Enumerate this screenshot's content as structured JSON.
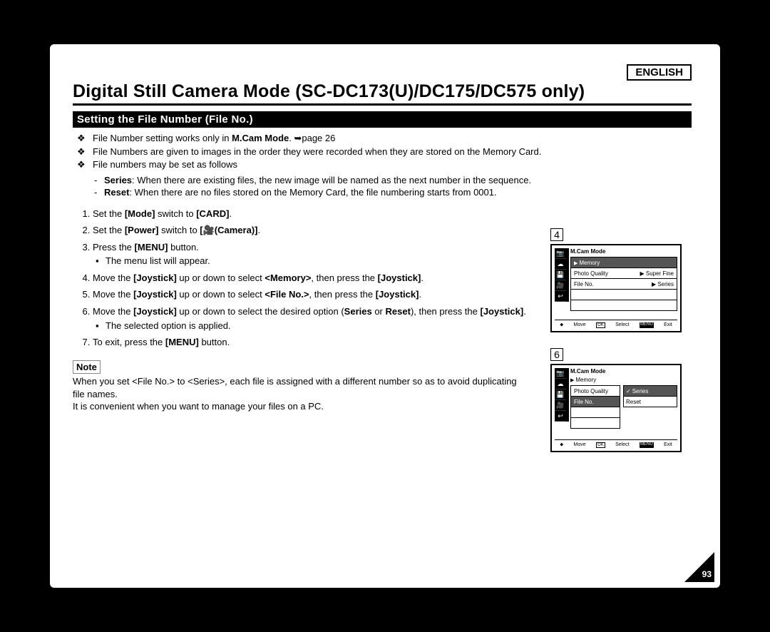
{
  "language": "ENGLISH",
  "title": "Digital Still Camera Mode (SC-DC173(U)/DC175/DC575 only)",
  "subtitle": "Setting the File Number (File No.)",
  "bullets": [
    "File Number setting works only in <b>M.Cam Mode</b>. ➥page 26",
    "File Numbers are given to images in the order they were recorded when they are stored on the Memory Card.",
    "File numbers may be set as follows"
  ],
  "sub_bullets": [
    "<b>Series</b>: When there are existing files, the new image will be named as the next number in the sequence.",
    "<b>Reset</b>: When there are no files stored on the Memory Card, the file numbering starts from 0001."
  ],
  "steps": [
    "Set the <b>[Mode]</b> switch to <b>[CARD]</b>.",
    "Set the <b>[Power]</b> switch to <b>[&#x1F3A5;(Camera)]</b>.",
    "Press the <b>[MENU]</b> button.|The menu list will appear.",
    "Move the <b>[Joystick]</b> up or down to select <b>&lt;Memory&gt;</b>, then press the <b>[Joystick]</b>.",
    "Move the <b>[Joystick]</b> up or down to select <b>&lt;File No.&gt;</b>, then press the <b>[Joystick]</b>.",
    "Move the <b>[Joystick]</b> up or down to select the desired option (<b>Series</b> or <b>Reset</b>), then press the <b>[Joystick]</b>.|The selected option is applied.",
    "To exit, press the <b>[MENU]</b> button."
  ],
  "note_label": "Note",
  "note_text": "When you set &lt;File No.&gt; to &lt;Series&gt;, each file is assigned with a different number so as to avoid duplicating file names.<br>It is convenient when you want to manage your files on a PC.",
  "lcd4": {
    "num": "4",
    "mode": "M.Cam Mode",
    "items": [
      {
        "label": "Memory",
        "sel": true,
        "tri": true
      },
      {
        "label": "Photo Quality",
        "right": "Super Fine",
        "rtri": true
      },
      {
        "label": "File No.",
        "right": "Series",
        "rtri": true
      }
    ],
    "foot_move": "Move",
    "foot_select": "Select",
    "foot_exit": "Exit"
  },
  "lcd6": {
    "num": "6",
    "mode": "M.Cam Mode",
    "crumb": "Memory",
    "items": [
      {
        "label": "Photo Quality"
      },
      {
        "label": "File No.",
        "sel": true
      }
    ],
    "sub": [
      {
        "label": "Series",
        "sel": true,
        "chk": true
      },
      {
        "label": "Reset"
      }
    ],
    "foot_move": "Move",
    "foot_select": "Select",
    "foot_exit": "Exit"
  },
  "page_number": "93"
}
